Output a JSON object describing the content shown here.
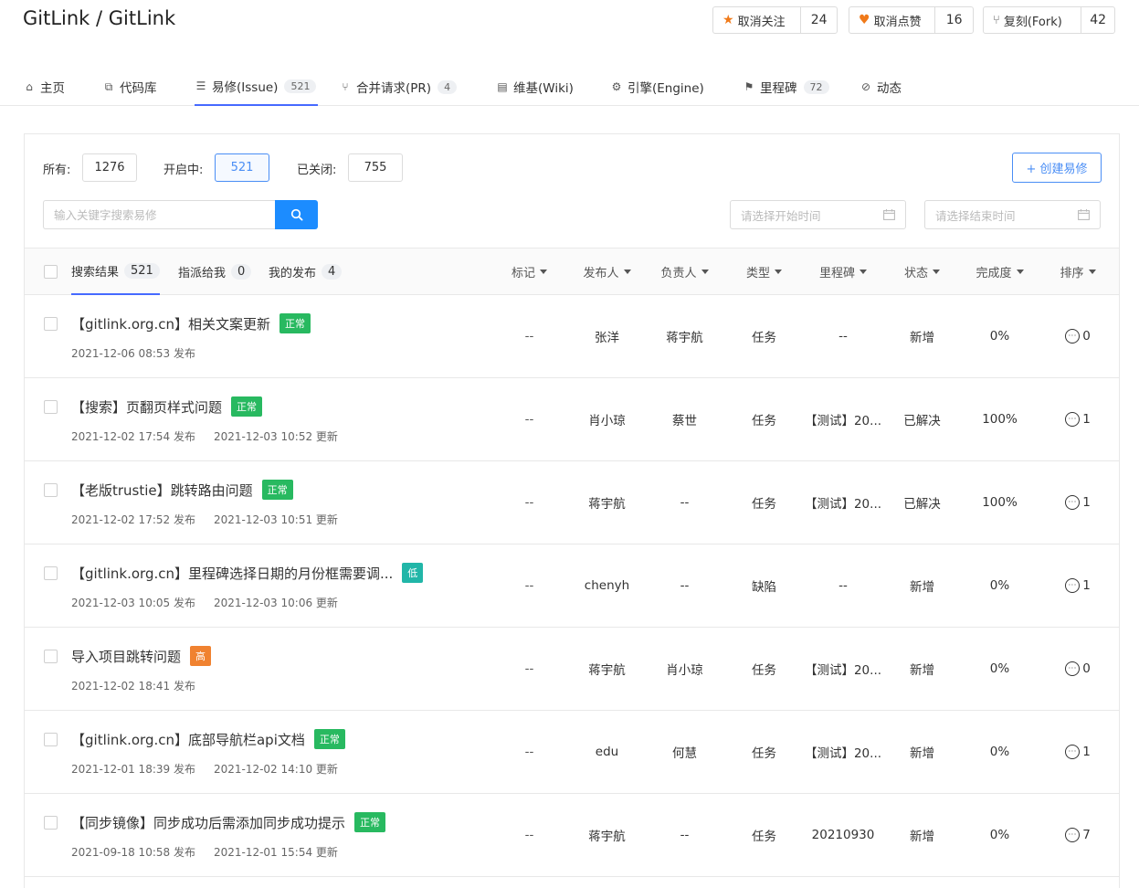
{
  "repo": {
    "title": "GitLink / GitLink"
  },
  "actions": {
    "watch": {
      "label": "取消关注",
      "count": "24"
    },
    "like": {
      "label": "取消点赞",
      "count": "16"
    },
    "fork": {
      "label": "复刻(Fork)",
      "count": "42"
    }
  },
  "tabs": [
    {
      "label": "主页",
      "count": ""
    },
    {
      "label": "代码库",
      "count": ""
    },
    {
      "label": "易修(Issue)",
      "count": "521"
    },
    {
      "label": "合并请求(PR)",
      "count": "4"
    },
    {
      "label": "维基(Wiki)",
      "count": ""
    },
    {
      "label": "引擎(Engine)",
      "count": ""
    },
    {
      "label": "里程碑",
      "count": "72"
    },
    {
      "label": "动态",
      "count": ""
    }
  ],
  "filters": {
    "all_label": "所有:",
    "all_count": "1276",
    "open_label": "开启中:",
    "open_count": "521",
    "closed_label": "已关闭:",
    "closed_count": "755"
  },
  "create_button": "+ 创建易修",
  "search": {
    "placeholder": "输入关键字搜索易修"
  },
  "date_start_placeholder": "请选择开始时间",
  "date_end_placeholder": "请选择结束时间",
  "table_tabs": {
    "results_label": "搜索结果",
    "results_count": "521",
    "assigned_label": "指派给我",
    "assigned_count": "0",
    "mine_label": "我的发布",
    "mine_count": "4"
  },
  "columns": [
    "标记",
    "发布人",
    "负责人",
    "类型",
    "里程碑",
    "状态",
    "完成度",
    "排序"
  ],
  "issues": [
    {
      "title": "【gitlink.org.cn】相关文案更新",
      "priority": "正常",
      "published": "2021-12-06 08:53 发布",
      "updated": "",
      "tag": "--",
      "author": "张洋",
      "assignee": "蒋宇航",
      "type": "任务",
      "milestone": "--",
      "status": "新增",
      "progress": "0%",
      "comments": "0"
    },
    {
      "title": "【搜索】页翻页样式问题",
      "priority": "正常",
      "published": "2021-12-02 17:54 发布",
      "updated": "2021-12-03 10:52 更新",
      "tag": "--",
      "author": "肖小琼",
      "assignee": "蔡世",
      "type": "任务",
      "milestone": "【测试】20...",
      "status": "已解决",
      "progress": "100%",
      "comments": "1"
    },
    {
      "title": "【老版trustie】跳转路由问题",
      "priority": "正常",
      "published": "2021-12-02 17:52 发布",
      "updated": "2021-12-03 10:51 更新",
      "tag": "--",
      "author": "蒋宇航",
      "assignee": "--",
      "type": "任务",
      "milestone": "【测试】20...",
      "status": "已解决",
      "progress": "100%",
      "comments": "1"
    },
    {
      "title": "【gitlink.org.cn】里程碑选择日期的月份框需要调...",
      "priority": "低",
      "published": "2021-12-03 10:05 发布",
      "updated": "2021-12-03 10:06 更新",
      "tag": "--",
      "author": "chenyh",
      "assignee": "--",
      "type": "缺陷",
      "milestone": "--",
      "status": "新增",
      "progress": "0%",
      "comments": "1"
    },
    {
      "title": "导入项目跳转问题",
      "priority": "高",
      "published": "2021-12-02 18:41 发布",
      "updated": "",
      "tag": "--",
      "author": "蒋宇航",
      "assignee": "肖小琼",
      "type": "任务",
      "milestone": "【测试】20...",
      "status": "新增",
      "progress": "0%",
      "comments": "0"
    },
    {
      "title": "【gitlink.org.cn】底部导航栏api文档",
      "priority": "正常",
      "published": "2021-12-01 18:39 发布",
      "updated": "2021-12-02 14:10 更新",
      "tag": "--",
      "author": "edu",
      "assignee": "何慧",
      "type": "任务",
      "milestone": "【测试】20...",
      "status": "新增",
      "progress": "0%",
      "comments": "1"
    },
    {
      "title": "【同步镜像】同步成功后需添加同步成功提示",
      "priority": "正常",
      "published": "2021-09-18 10:58 发布",
      "updated": "2021-12-01 15:54 更新",
      "tag": "--",
      "author": "蒋宇航",
      "assignee": "--",
      "type": "任务",
      "milestone": "20210930",
      "status": "新增",
      "progress": "0%",
      "comments": "7"
    }
  ]
}
